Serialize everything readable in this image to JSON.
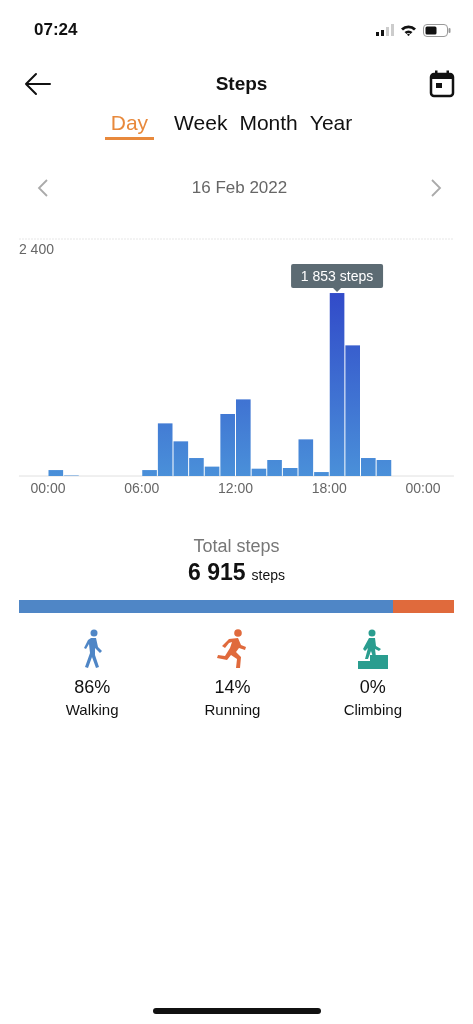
{
  "status_bar": {
    "time": "07:24"
  },
  "header": {
    "title": "Steps"
  },
  "tabs": [
    {
      "label": "Day",
      "selected": true
    },
    {
      "label": "Week",
      "selected": false
    },
    {
      "label": "Month",
      "selected": false
    },
    {
      "label": "Year",
      "selected": false
    }
  ],
  "date_nav": {
    "date": "16 Feb 2022"
  },
  "chart": {
    "top_label": "2 400",
    "tooltip": "1 853 steps",
    "x_labels": [
      "00:00",
      "06:00",
      "12:00",
      "18:00",
      "00:00"
    ]
  },
  "total": {
    "label": "Total steps",
    "value": "6 915",
    "unit": "steps"
  },
  "activities": [
    {
      "kind": "walking",
      "percent": "86%",
      "label": "Walking",
      "color": "#4f86c6"
    },
    {
      "kind": "running",
      "percent": "14%",
      "label": "Running",
      "color": "#e06a3c"
    },
    {
      "kind": "climbing",
      "percent": "0%",
      "label": "Climbing",
      "color": "#2a9d8f"
    }
  ]
}
